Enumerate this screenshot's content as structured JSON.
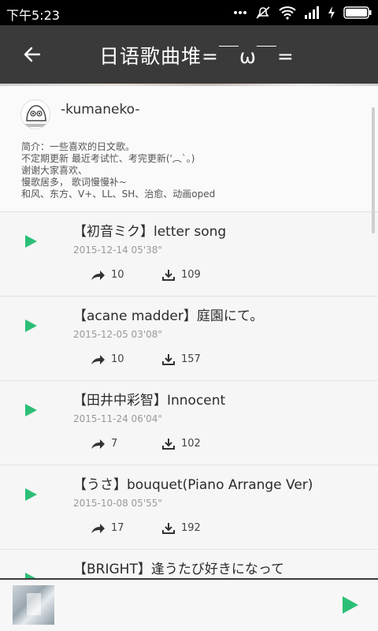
{
  "status": {
    "time": "下午5:23"
  },
  "appbar": {
    "title": "日语歌曲堆=￣ω￣="
  },
  "playlist": {
    "author": "-kumaneko-",
    "description_lines": [
      "简介：一些喜欢的日文歌。",
      "不定期更新 最近考试忙、考完更新('︵`｡)",
      "谢谢大家喜欢、",
      "慢歌居多， 歌词慢慢补~",
      "和风、东方、V+、LL、SH、治愈、动画oped"
    ]
  },
  "songs": [
    {
      "title": "【初音ミク】letter song",
      "date": "2015-12-14  05'38\"",
      "shares": "10",
      "downloads": "109"
    },
    {
      "title": "【acane madder】庭園にて。",
      "date": "2015-12-05  03'08\"",
      "shares": "10",
      "downloads": "157"
    },
    {
      "title": "【田井中彩智】Innocent",
      "date": "2015-11-24  06'04\"",
      "shares": "7",
      "downloads": "102"
    },
    {
      "title": "【うさ】bouquet(Piano Arrange Ver)",
      "date": "2015-10-08  05'55\"",
      "shares": "17",
      "downloads": "192"
    },
    {
      "title": "【BRIGHT】逢うたび好きになって",
      "date": "",
      "shares": "",
      "downloads": ""
    }
  ],
  "colors": {
    "accent": "#2bbf76",
    "appbar": "#3a3a3a"
  }
}
